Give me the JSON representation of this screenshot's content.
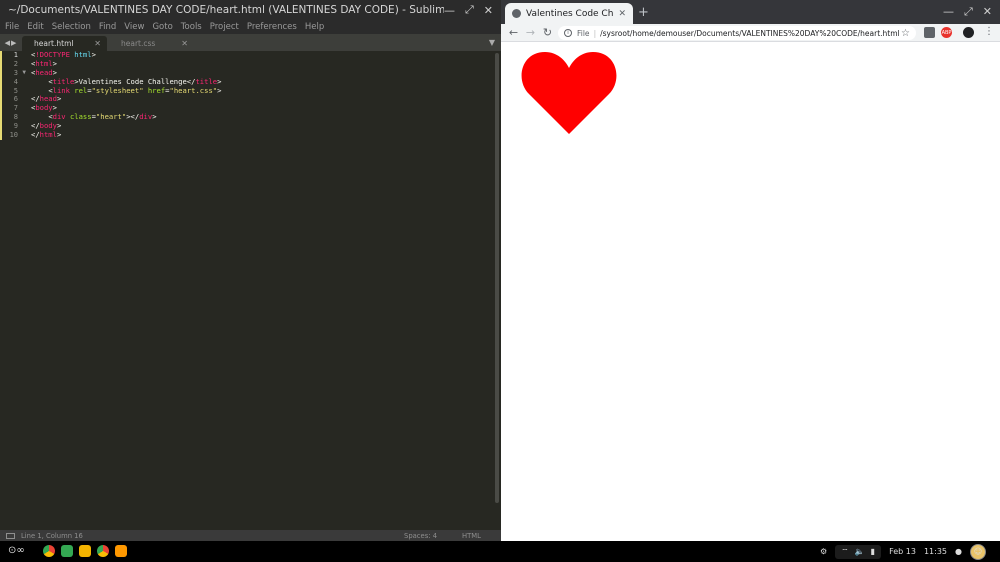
{
  "sublime": {
    "title": "~/Documents/VALENTINES DAY CODE/heart.html (VALENTINES DAY CODE) - Sublime Text (UNREGISTER...",
    "menu": [
      "File",
      "Edit",
      "Selection",
      "Find",
      "View",
      "Goto",
      "Tools",
      "Project",
      "Preferences",
      "Help"
    ],
    "tabs": [
      {
        "label": "heart.html",
        "active": true
      },
      {
        "label": "heart.css",
        "active": false
      }
    ],
    "line_numbers": [
      "1",
      "2",
      "3",
      "4",
      "5",
      "6",
      "7",
      "8",
      "9",
      "10"
    ],
    "status": {
      "position": "Line 1, Column 16",
      "spaces": "Spaces: 4",
      "syntax": "HTML"
    }
  },
  "code_lines": [
    "<!DOCTYPE html>",
    "<html>",
    "<head>",
    "    <title>Valentines Code Challenge</title>",
    "    <link rel=\"stylesheet\" href=\"heart.css\">",
    "</head>",
    "<body>",
    "    <div class=\"heart\"></div>",
    "</body>",
    "</html>"
  ],
  "chrome": {
    "tab_title": "Valentines Code Challen",
    "omnibox": {
      "scheme_chip": "File",
      "url": "/sysroot/home/demouser/Documents/VALENTINES%20DAY%20CODE/heart.html"
    },
    "extensions": {
      "abp": "ABP"
    },
    "heart_color": "#ff0000"
  },
  "taskbar": {
    "date": "Feb 13",
    "time": "11:35"
  },
  "icons": [
    "back-arrow-icon",
    "forward-arrow-icon",
    "reload-icon",
    "info-icon",
    "star-icon",
    "kebab-menu-icon",
    "profile-icon",
    "globe-icon",
    "close-icon",
    "minimize-icon",
    "maximize-icon",
    "wifi-icon",
    "volume-icon",
    "battery-icon",
    "gear-icon"
  ]
}
